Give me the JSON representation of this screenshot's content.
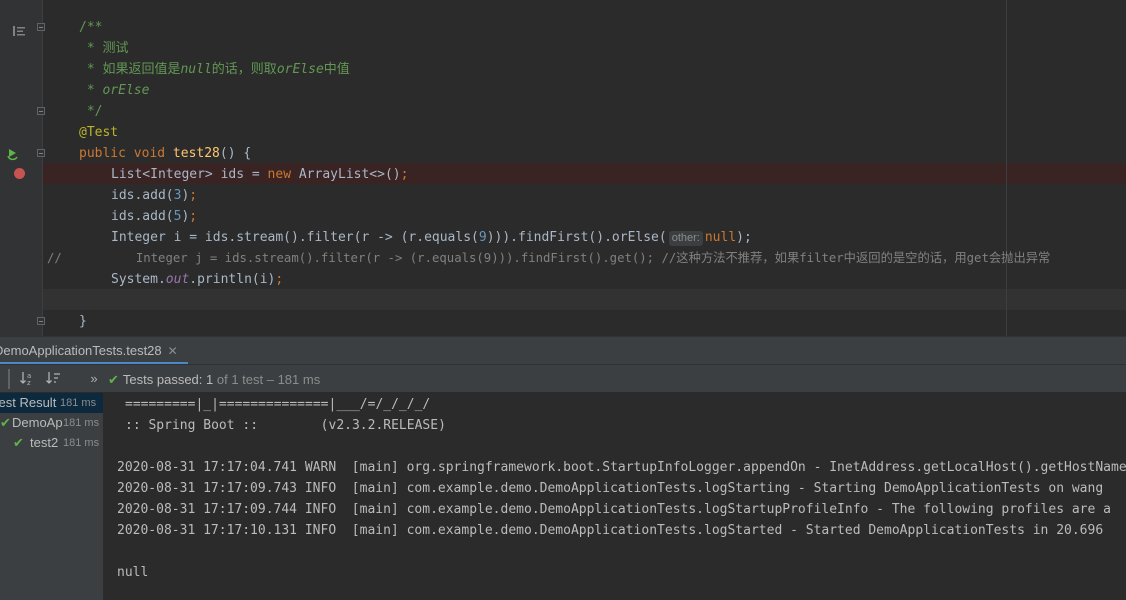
{
  "editor": {
    "lines": [
      {
        "text": "/**"
      },
      {
        "text": " * 测试"
      },
      {
        "pre": " * 如果返回值是",
        "i1": "null",
        "mid": "的话，则取",
        "i2": "orElse",
        "post": "中值"
      },
      {
        "pre": " * ",
        "i1": "orElse"
      },
      {
        "text": " */"
      },
      {
        "text": "@Test"
      },
      {
        "kw1": "public void ",
        "fn": "test28",
        "rest": "() {"
      },
      {
        "a": "List<Integer> ids = ",
        "kw": "new",
        "b": " ArrayList<>()",
        "c": ";"
      },
      {
        "a": "ids.add(",
        "num": "3",
        "b": ")",
        "c": ";"
      },
      {
        "a": "ids.add(",
        "num": "5",
        "b": ")",
        "c": ";"
      },
      {
        "a": "Integer i = ids.stream().filter(r -> (r.equals(",
        "num": "9",
        "b": "))).findFirst().orElse(",
        "hint": "other:",
        "kw": "null",
        "c": ");"
      },
      {
        "prefix": "//",
        "text": "          Integer j = ids.stream().filter(r -> (r.equals(9))).findFirst().get(); //这种方法不推荐，如果filter中返回的是空的话，用get会抛出异常"
      },
      {
        "a": "System.",
        "st": "out",
        "b": ".println(i)",
        "c": ";"
      },
      {
        "text": ""
      },
      {
        "text": "}"
      }
    ]
  },
  "run": {
    "tab_label": "DemoApplicationTests.test28",
    "tab_close": "✕",
    "status_passed_label": "Tests passed: ",
    "status_count": "1",
    "status_rest": " of 1 test – 181 ms",
    "tree": [
      {
        "label": "Test Result",
        "time": "181 ms"
      },
      {
        "label": "DemoAp",
        "time": "181 ms"
      },
      {
        "label": "test2",
        "time": "181 ms"
      }
    ],
    "console": [
      "=========|_|==============|___/=/_/_/_/",
      ":: Spring Boot ::        (v2.3.2.RELEASE)",
      "",
      "2020-08-31 17:17:04.741 WARN  [main] org.springframework.boot.StartupInfoLogger.appendOn - InetAddress.getLocalHost().getHostName",
      "2020-08-31 17:17:09.743 INFO  [main] com.example.demo.DemoApplicationTests.logStarting - Starting DemoApplicationTests on wang",
      "2020-08-31 17:17:09.744 INFO  [main] com.example.demo.DemoApplicationTests.logStartupProfileInfo - The following profiles are a",
      "2020-08-31 17:17:10.131 INFO  [main] com.example.demo.DemoApplicationTests.logStarted - Started DemoApplicationTests in 20.696",
      "",
      "null"
    ]
  },
  "colors": {
    "accent": "#4a88c7",
    "pass": "#5fb349",
    "breakpoint": "#c75450"
  }
}
